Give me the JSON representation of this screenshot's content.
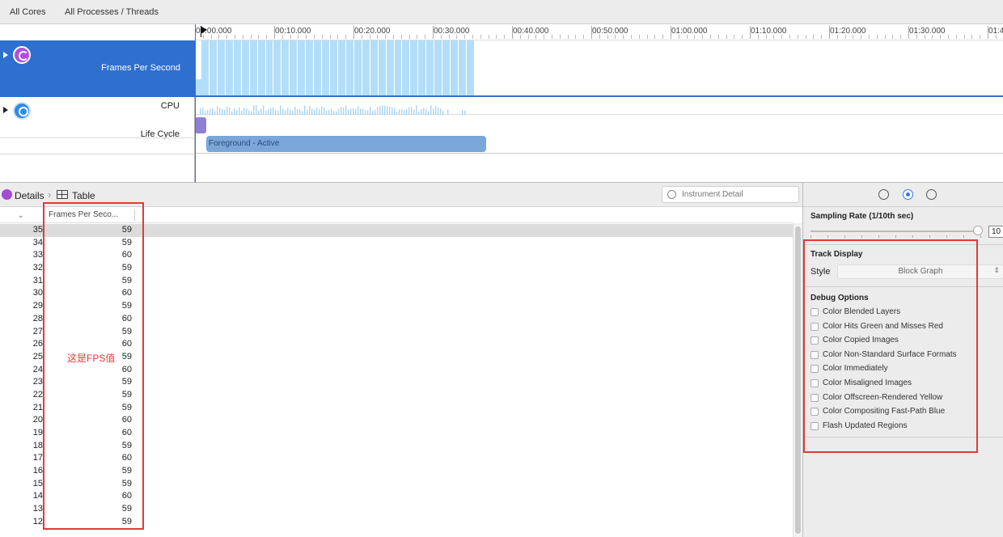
{
  "topbar": {
    "cores_label": "All Cores",
    "processes_label": "All Processes / Threads"
  },
  "ruler": {
    "labels": [
      "00:00.000",
      "00:10.000",
      "00:20.000",
      "00:30.000",
      "00:40.000",
      "00:50.000",
      "01:00.000",
      "01:10.000",
      "01:20.000",
      "01:30.000",
      "01:4"
    ]
  },
  "tracks": {
    "fps_label": "Frames Per Second",
    "cpu_label": "CPU",
    "lifecycle_label": "Life Cycle",
    "lifecycle_state": "Foreground - Active"
  },
  "details": {
    "breadcrumb_details": "Details",
    "breadcrumb_table": "Table",
    "search_placeholder": "Instrument Detail",
    "column_header": "Frames Per Seco...",
    "annotation": "这是FPS值",
    "rows": [
      {
        "index": "35",
        "value": "59"
      },
      {
        "index": "34",
        "value": "59"
      },
      {
        "index": "33",
        "value": "60"
      },
      {
        "index": "32",
        "value": "59"
      },
      {
        "index": "31",
        "value": "59"
      },
      {
        "index": "30",
        "value": "60"
      },
      {
        "index": "29",
        "value": "59"
      },
      {
        "index": "28",
        "value": "60"
      },
      {
        "index": "27",
        "value": "59"
      },
      {
        "index": "26",
        "value": "60"
      },
      {
        "index": "25",
        "value": "59"
      },
      {
        "index": "24",
        "value": "60"
      },
      {
        "index": "23",
        "value": "59"
      },
      {
        "index": "22",
        "value": "59"
      },
      {
        "index": "21",
        "value": "59"
      },
      {
        "index": "20",
        "value": "60"
      },
      {
        "index": "19",
        "value": "60"
      },
      {
        "index": "18",
        "value": "59"
      },
      {
        "index": "17",
        "value": "60"
      },
      {
        "index": "16",
        "value": "59"
      },
      {
        "index": "15",
        "value": "59"
      },
      {
        "index": "14",
        "value": "60"
      },
      {
        "index": "13",
        "value": "59"
      },
      {
        "index": "12",
        "value": "59"
      }
    ]
  },
  "inspector": {
    "sampling_title": "Sampling Rate (1/10th sec)",
    "sampling_value": "10",
    "track_display_title": "Track Display",
    "style_label": "Style",
    "style_value": "Block Graph",
    "debug_title": "Debug Options",
    "debug_options": [
      "Color Blended Layers",
      "Color Hits Green and Misses Red",
      "Color Copied Images",
      "Color Non-Standard Surface Formats",
      "Color Immediately",
      "Color Misaligned Images",
      "Color Offscreen-Rendered Yellow",
      "Color Compositing Fast-Path Blue",
      "Flash Updated Regions"
    ]
  },
  "colors": {
    "selection": "#2e6fcf",
    "fps_bar": "#b3defa",
    "lifecycle_bar": "#7aa6d8",
    "annotation": "#e53935"
  }
}
